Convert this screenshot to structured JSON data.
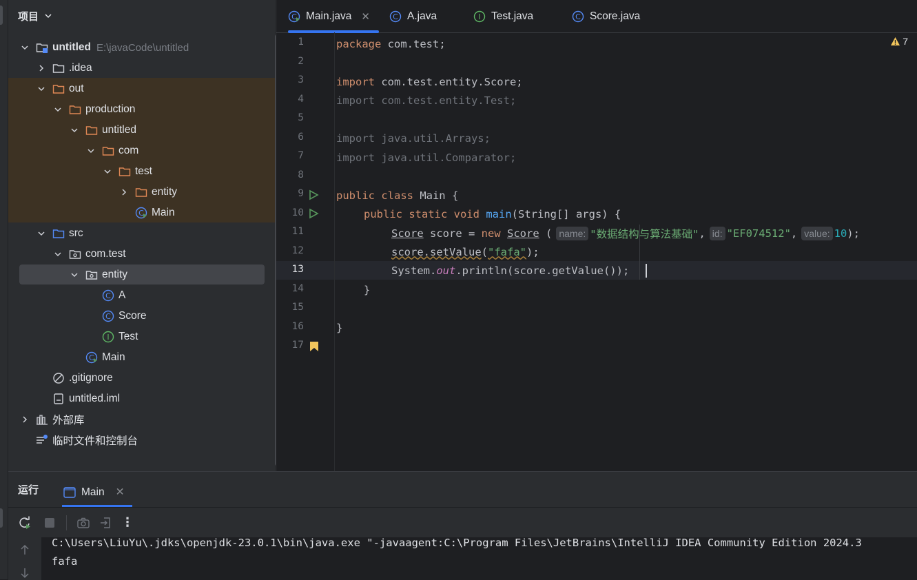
{
  "project_panel": {
    "title": "项目",
    "tree": [
      {
        "label": "untitled",
        "path": "E:\\javaCode\\untitled",
        "icon": "module-folder-icon",
        "depth": 0,
        "expanded": true
      },
      {
        "label": ".idea",
        "icon": "folder-icon",
        "depth": 1,
        "expanded": false
      },
      {
        "label": "out",
        "icon": "excluded-folder-icon",
        "depth": 1,
        "expanded": true
      },
      {
        "label": "production",
        "icon": "excluded-folder-icon",
        "depth": 2,
        "expanded": true
      },
      {
        "label": "untitled",
        "icon": "excluded-folder-icon",
        "depth": 3,
        "expanded": true
      },
      {
        "label": "com",
        "icon": "excluded-folder-icon",
        "depth": 4,
        "expanded": true
      },
      {
        "label": "test",
        "icon": "excluded-folder-icon",
        "depth": 5,
        "expanded": true
      },
      {
        "label": "entity",
        "icon": "excluded-folder-icon",
        "depth": 6,
        "expanded": false
      },
      {
        "label": "Main",
        "icon": "runnable-class-icon",
        "depth": 6
      },
      {
        "label": "src",
        "icon": "source-folder-icon",
        "depth": 1,
        "expanded": true
      },
      {
        "label": "com.test",
        "icon": "package-icon",
        "depth": 2,
        "expanded": true
      },
      {
        "label": "entity",
        "icon": "package-icon",
        "depth": 3,
        "expanded": true,
        "selected": true
      },
      {
        "label": "A",
        "icon": "class-icon",
        "depth": 4
      },
      {
        "label": "Score",
        "icon": "class-icon",
        "depth": 4
      },
      {
        "label": "Test",
        "icon": "interface-icon",
        "depth": 4
      },
      {
        "label": "Main",
        "icon": "runnable-class-icon",
        "depth": 3
      },
      {
        "label": ".gitignore",
        "icon": "ignore-file-icon",
        "depth": 1
      },
      {
        "label": "untitled.iml",
        "icon": "iml-file-icon",
        "depth": 1
      },
      {
        "label": "外部库",
        "icon": "library-icon",
        "depth": 0,
        "expanded": false
      },
      {
        "label": "临时文件和控制台",
        "icon": "scratches-icon",
        "depth": 0
      }
    ]
  },
  "editor": {
    "tabs": [
      {
        "label": "Main.java",
        "icon": "runnable-class-icon",
        "active": true,
        "closable": true
      },
      {
        "label": "A.java",
        "icon": "class-icon"
      },
      {
        "label": "Test.java",
        "icon": "interface-icon"
      },
      {
        "label": "Score.java",
        "icon": "class-icon"
      }
    ],
    "warnings_count": "7",
    "current_line": 13,
    "line_numbers": [
      "1",
      "2",
      "3",
      "4",
      "5",
      "6",
      "7",
      "8",
      "9",
      "10",
      "11",
      "12",
      "13",
      "14",
      "15",
      "16",
      "17"
    ],
    "code": {
      "l1_kw": "package",
      "l1_rest": " com.test;",
      "l3_kw": "import",
      "l3_rest": " com.test.entity.Score;",
      "l4": "import com.test.entity.Test;",
      "l6": "import java.util.Arrays;",
      "l7": "import java.util.Comparator;",
      "l9_kw": "public class",
      "l9_rest": " Main {",
      "l10_kw": "public static void",
      "l10_fn": "main",
      "l10_rest": "(String[] args) {",
      "l11_type": "Score",
      "l11_a": " score = ",
      "l11_new": "new",
      "l11_ctor": "Score",
      "l11_paren": " (",
      "l11_hint1": "name:",
      "l11_s1": "\"数据结构与算法基础\"",
      "l11_c1": ",",
      "l11_hint2": "id:",
      "l11_s2": "\"EF074512\"",
      "l11_c2": ",",
      "l11_hint3": "value:",
      "l11_n": "10",
      "l11_end": ");",
      "l12_a": "score.setValue",
      "l12_p": "(",
      "l12_s": "\"fafa\"",
      "l12_end": ");",
      "l13_a": "System.",
      "l13_out": "out",
      "l13_b": ".println(score.getValue());",
      "l14": "}",
      "l16": "}"
    }
  },
  "run_panel": {
    "title": "运行",
    "tab_label": "Main",
    "console": [
      "C:\\Users\\LiuYu\\.jdks\\openjdk-23.0.1\\bin\\java.exe \"-javaagent:C:\\Program Files\\JetBrains\\IntelliJ IDEA Community Edition 2024.3",
      "fafa"
    ]
  },
  "colors": {
    "accent": "#3574f0",
    "keyword": "#cf8e6d",
    "string": "#6aab73",
    "number": "#2aacb8",
    "function": "#56a8f5",
    "static_field": "#c77dbb",
    "excluded_bg": "#3d3223"
  }
}
